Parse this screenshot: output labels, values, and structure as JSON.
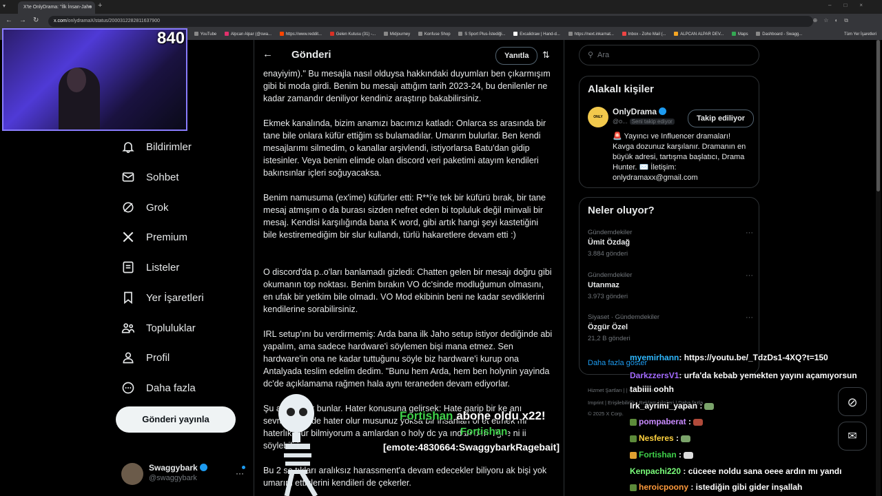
{
  "browser": {
    "tab_title": "X'te OnlyDrama: \"İlk İnsan-Jaho",
    "url_host": "x.com",
    "url_path": "/onlydramaX/status/2000312282811637900",
    "bookmarks": [
      "YouTube",
      "Alpcan Alpar (@swa...",
      "https://www.reddit...",
      "Gelen Kutusu (31) -...",
      "Midjourney",
      "Konfuse Shop",
      "S Sport Plus-İstediği...",
      "Excalidraw | Hand-d...",
      "https://next.inkarnat...",
      "Inbox - Zoho Mail (...",
      "ALPCAN ALPAR DEV...",
      "Maps",
      "Dashboard - Swagg..."
    ],
    "bookmarks_right": "Tüm Yer İşaretleri"
  },
  "stream": {
    "viewers": "840",
    "alert_name": "Fortishan",
    "alert_text": "abone oldu x22!",
    "alert_name2": "Fortishan",
    "alert_emote": "[emote:4830664:SwaggybarkRagebait]",
    "chat": [
      {
        "user": "myemirhann",
        "color": "#2fb8ff",
        "msg": ": https://youtu.be/_TdzDs1-4XQ?t=150"
      },
      {
        "user": "DarkzzersV1",
        "color": "#a46bff",
        "msg": ": urfa'da kebab yemekten yayını açamıyorsun"
      },
      {
        "user": "",
        "color": "#ffffff",
        "msg": "tabiiii oohh"
      },
      {
        "user": "Irk_ayrimi_yapan",
        "color": "#ffffff",
        "msg": " :"
      },
      {
        "user": "pompaberat",
        "color": "#c98bff",
        "msg": " :"
      },
      {
        "user": "Nesferes",
        "color": "#ffd23f",
        "msg": " :"
      },
      {
        "user": "Fortishan",
        "color": "#3fd14a",
        "msg": " :"
      },
      {
        "user": "Kenpachi220",
        "color": "#7bff7b",
        "msg": " : cüceee noldu sana oeee ardın mı yandı"
      },
      {
        "user": "heroicpoony",
        "color": "#ff9a3c",
        "msg": " : istediğin gibi gider inşallah"
      }
    ]
  },
  "nav": {
    "items": [
      "Bildirimler",
      "Sohbet",
      "Grok",
      "Premium",
      "Listeler",
      "Yer İşaretleri",
      "Topluluklar",
      "Profil",
      "Daha fazla"
    ],
    "post_button": "Gönderi yayınla",
    "account_name": "Swaggybark",
    "account_handle": "@swaggybark"
  },
  "main": {
    "back": "←",
    "title": "Gönderi",
    "reply_button": "Yanıtla",
    "paragraphs": [
      "enayiyim).\"  Bu mesajla nasıl olduysa hakkındaki duyumları ben çıkarmışım gibi bi moda girdi. Benim bu mesajı attığım tarih 2023-24, bu denilenler ne kadar zamandır deniliyor kendiniz araştırıp bakabilirsiniz.",
      "Ekmek kanalında, bizim anamızı bacımızı katladı: Onlarca ss arasında bir tane bile onlara küfür ettiğim ss bulamadılar. Umarım bulurlar. Ben kendi mesajlarımı silmedim, o kanallar arşivlendi, istiyorlarsa Batu'dan gidip istesinler. Veya benim elimde olan discord veri paketimi atayım kendileri bakınsınlar içleri soğuyacaksa.",
      "Benim namusuma (ex'ime) küfürler etti: R**i'e tek bir küfürü bırak, bir tane mesaj atmışım o da burası sizden nefret eden bi topluluk değil minvali bir mesaj. Kendisi karşılığında bana K word, gibi artık hangi şeyi kastetiğini bile kestiremediğim bir slur kullandı, türlü hakaretlere devam etti :)",
      "O discord'da p..o'ları banlamadı gizledi: Chatten gelen bir mesajı doğru gibi okumanın top noktası. Benim bırakın VO dc'sinde modluğumun olmasını, en ufak bir yetkim bile olmadı. VO Mod ekibinin beni ne kadar sevdiklerini kendilerine sorabilirsiniz.",
      "IRL setup'ını bu verdirmemiş: Arda bana ilk Jaho setup istiyor dediğinde abi yapalım, ama sadece hardware'i söylemen bişi mana etmez. Sen hardware'in ona ne kadar tuttuğunu söyle biz hardware'i kurup ona Antalyada teslim edelim dedim. \"Bunu hem Arda, hem ben holynin yayinda dc'de açıklamama rağmen hala aynı teraneden devam ediyorlar.",
      "Şu       a gelenler bunlar.  Hater konusuna gelirsek: Hate garip bir ke        anı sevmeseniz de hater olur musunuz yoksa bir insanları öl        et etmek mi haterlık olur bilmiyorum a                 amlardan o holy dc ya    ından beri iliği    e    ni            ii söylebilirim.",
      "Bu 2 se        tıkları aralıksız harassment'a devam edecekler biliyoru       ak bişi yok umarım ettiklerini kendileri de çekerler."
    ]
  },
  "right": {
    "search_placeholder": "Ara",
    "related_title": "Alakalı kişiler",
    "related_name": "OnlyDrama",
    "related_handle": "@o...",
    "related_pill": "Seni takip ediyor",
    "related_follow": "Takip ediliyor",
    "related_bio": "🚨 Yayıncı ve Influencer dramaları! Kavga dozunuz karşılanır. Dramanın en büyük adresi, tartışma başlatıcı, Drama Hunter. ✉️ İletişim: onlydramaxx@gmail.com",
    "trends_title": "Neler oluyor?",
    "trends": [
      {
        "category": "Gündemdekiler",
        "name": "Ümit Özdağ",
        "count": "3.884 gönderi"
      },
      {
        "category": "Gündemdekiler",
        "name": "Utanmaz",
        "count": "3.973 gönderi"
      },
      {
        "category": "Siyaset · Gündemdekiler",
        "name": "Özgür Özel",
        "count": "21,2 B gönderi"
      }
    ],
    "show_more": "Daha fazla göster",
    "footer1": "Hizmet Şartları  |           |  Çerez Politikası  |",
    "footer2": "Imprint  |  Erişilebilirlik  |  Reklam bilgileri  |  Daha fazla ...",
    "footer3": "© 2025 X Corp."
  }
}
